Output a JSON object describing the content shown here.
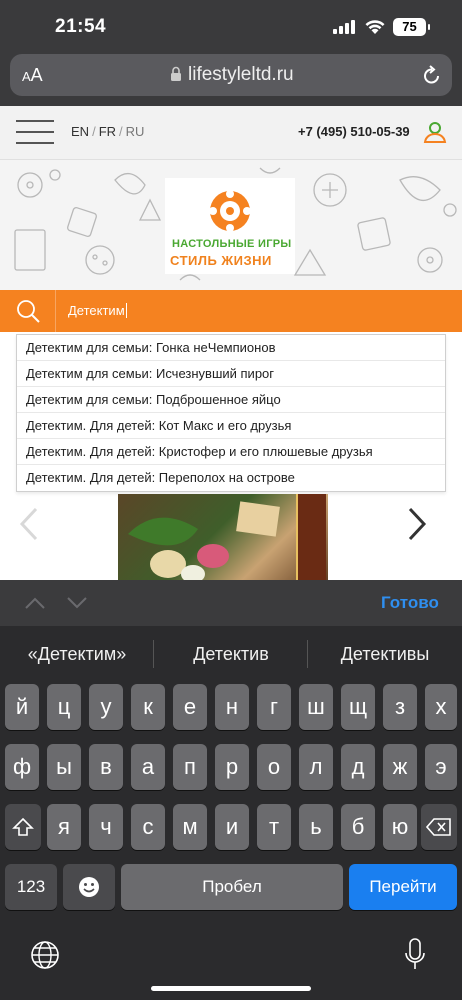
{
  "status": {
    "time": "21:54",
    "battery": "75"
  },
  "browser": {
    "text_size_label_small": "A",
    "text_size_label_large": "A",
    "url": "lifestyleltd.ru"
  },
  "site": {
    "languages": [
      "EN",
      "FR",
      "RU"
    ],
    "phone": "+7 (495) 510-05-39",
    "logo_line1": "НАСТОЛЬНЫЕ ИГРЫ",
    "logo_line2": "СТИЛЬ ЖИЗНИ",
    "search_value": "Детектим",
    "suggestions": [
      "Детектим для семьи: Гонка неЧемпионов",
      "Детектим для семьи: Исчезнувший пирог",
      "Детектим для семьи: Подброшенное яйцо",
      "Детектим. Для детей: Кот Макс и его друзья",
      "Детектим. Для детей: Кристофер и его плюшевые друзья",
      "Детектим. Для детей: Переполох на острове"
    ]
  },
  "keyboard": {
    "done_label": "Готово",
    "predictions": [
      "«Детектим»",
      "Детектив",
      "Детективы"
    ],
    "row1": [
      "й",
      "ц",
      "у",
      "к",
      "е",
      "н",
      "г",
      "ш",
      "щ",
      "з",
      "х"
    ],
    "row2": [
      "ф",
      "ы",
      "в",
      "а",
      "п",
      "р",
      "о",
      "л",
      "д",
      "ж",
      "э"
    ],
    "row3": [
      "я",
      "ч",
      "с",
      "м",
      "и",
      "т",
      "ь",
      "б",
      "ю"
    ],
    "numbers_label": "123",
    "space_label": "Пробел",
    "go_label": "Перейти"
  },
  "colors": {
    "brand_orange": "#f58220",
    "done_blue": "#2f8ff0",
    "go_blue": "#1a7ff0"
  }
}
